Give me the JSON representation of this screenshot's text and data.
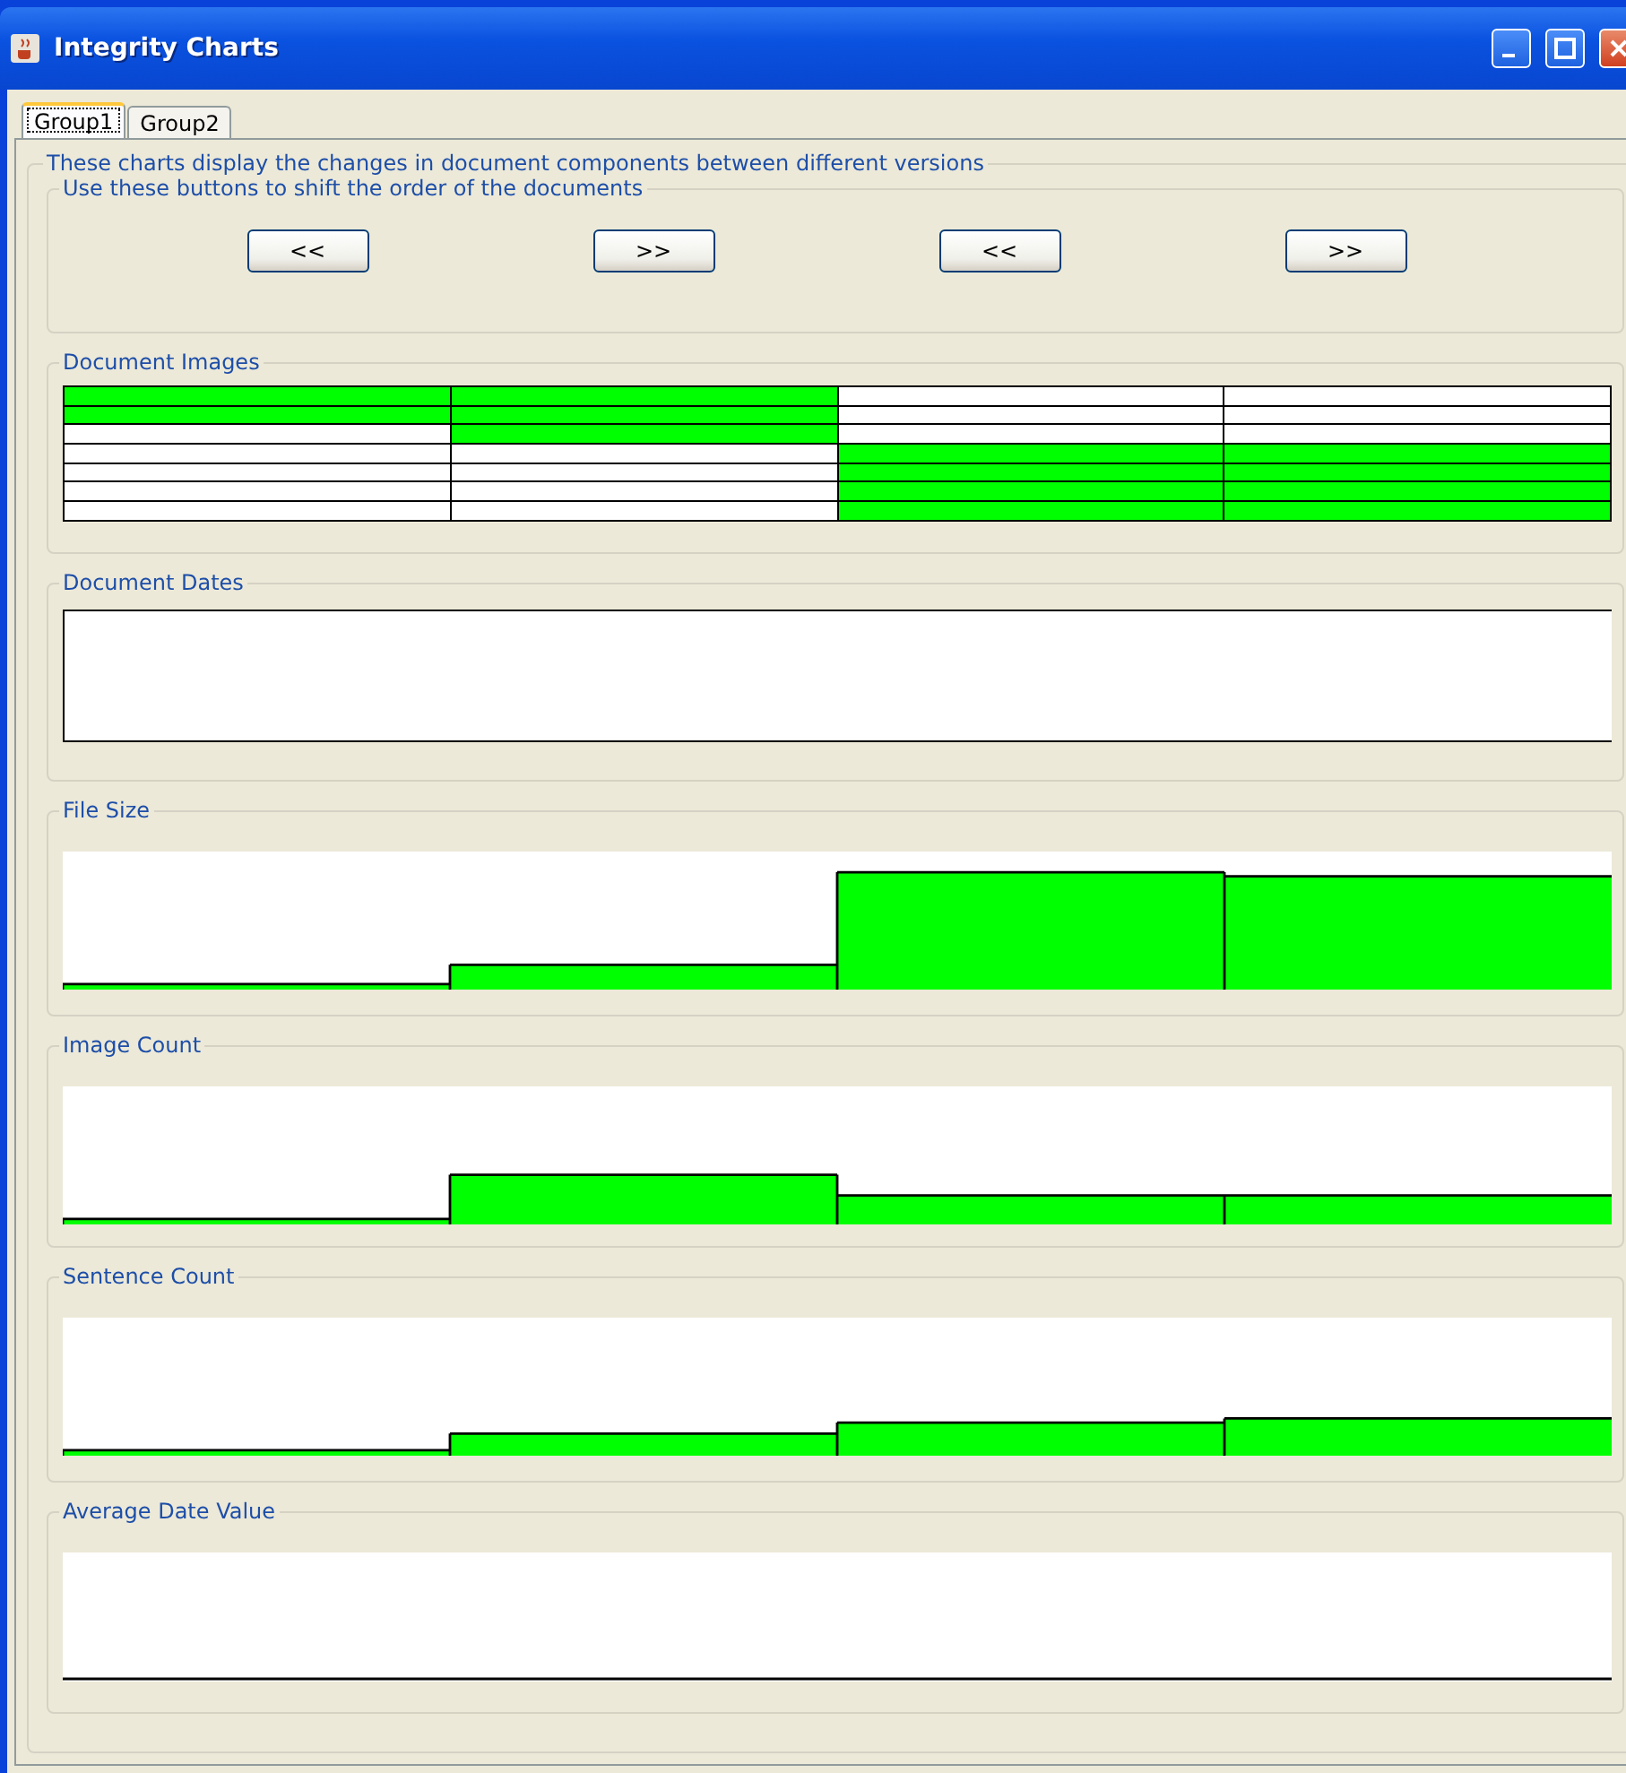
{
  "window": {
    "title": "Integrity Charts"
  },
  "tabs": [
    {
      "label": "Group1",
      "selected": true
    },
    {
      "label": "Group2",
      "selected": false
    }
  ],
  "intro": "These charts display the changes in document components between different versions",
  "shift_panel": {
    "title": "Use these buttons to shift the order of the documents",
    "buttons": [
      "<<",
      ">>",
      "<<",
      ">>"
    ]
  },
  "charts": [
    {
      "title": "Document Images",
      "kind": "grid",
      "columns": [
        {
          "cells": [
            {
              "filled": true
            },
            {
              "filled": true
            },
            {
              "filled": false
            },
            {
              "filled": false
            },
            {
              "filled": false
            },
            {
              "filled": false
            },
            {
              "filled": false
            }
          ]
        },
        {
          "cells": [
            {
              "filled": true
            },
            {
              "filled": true
            },
            {
              "filled": true
            },
            {
              "filled": false
            },
            {
              "filled": false
            },
            {
              "filled": false
            },
            {
              "filled": false
            }
          ]
        },
        {
          "cells": [
            {
              "filled": false
            },
            {
              "filled": false
            },
            {
              "filled": false
            },
            {
              "filled": true
            },
            {
              "filled": true
            },
            {
              "filled": true
            },
            {
              "filled": true
            }
          ]
        },
        {
          "cells": [
            {
              "filled": false
            },
            {
              "filled": false
            },
            {
              "filled": false
            },
            {
              "filled": true
            },
            {
              "filled": true
            },
            {
              "filled": true
            },
            {
              "filled": true
            }
          ]
        }
      ]
    },
    {
      "title": "Document Dates",
      "kind": "box"
    },
    {
      "title": "File Size",
      "kind": "steps"
    },
    {
      "title": "Image Count",
      "kind": "steps"
    },
    {
      "title": "Sentence Count",
      "kind": "steps"
    },
    {
      "title": "Average Date Value",
      "kind": "baseline"
    }
  ]
}
